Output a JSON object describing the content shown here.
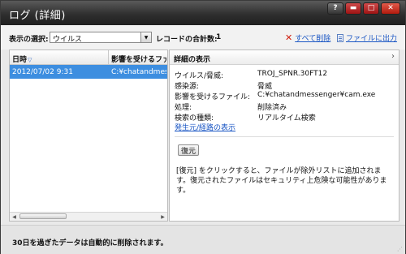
{
  "window": {
    "title": "ログ (詳細)",
    "controls": {
      "help": "?",
      "minimize": "▬",
      "maximize": "□",
      "close": "✕"
    }
  },
  "toolbar": {
    "view_label": "表示の選択:",
    "view_selected": "ウイルス",
    "record_label": "レコードの合計数:",
    "record_count": "1",
    "delete_all": "すべて削除",
    "export_file": "ファイルに出力"
  },
  "list": {
    "columns": [
      "日時",
      "影響を受けるファ"
    ],
    "rows": [
      {
        "date": "2012/07/02 9:31",
        "file": "C:¥chatandmess",
        "selected": true
      }
    ]
  },
  "detail": {
    "header": "詳細の表示",
    "fields": [
      {
        "label": "ウイルス/脅威:",
        "value": "TROJ_SPNR.30FT12"
      },
      {
        "label": "感染源:",
        "value": "脅威"
      },
      {
        "label": "影響を受けるファイル:",
        "value": "C:¥chatandmessenger¥cam.exe"
      },
      {
        "label": "処理:",
        "value": "削除済み"
      },
      {
        "label": "検索の種類:",
        "value": "リアルタイム検索"
      }
    ],
    "source_link": "発生元/経路の表示",
    "restore_button": "復元",
    "note": "[復元] をクリックすると、ファイルが除外リストに追加されます。復元されたファイルはセキュリティ上危険な可能性があります。"
  },
  "footer": {
    "text": "30日を過ぎたデータは自動的に削除されます。"
  },
  "icons": {
    "sort": "sort-desc-icon",
    "delete": "x-icon",
    "export": "document-icon",
    "chevron": "chevron-right-icon"
  },
  "colors": {
    "selection": "#3d8ee0",
    "link": "#1a56c4",
    "titlebar": "#2f2f2f",
    "close_button": "#b21b0e"
  }
}
